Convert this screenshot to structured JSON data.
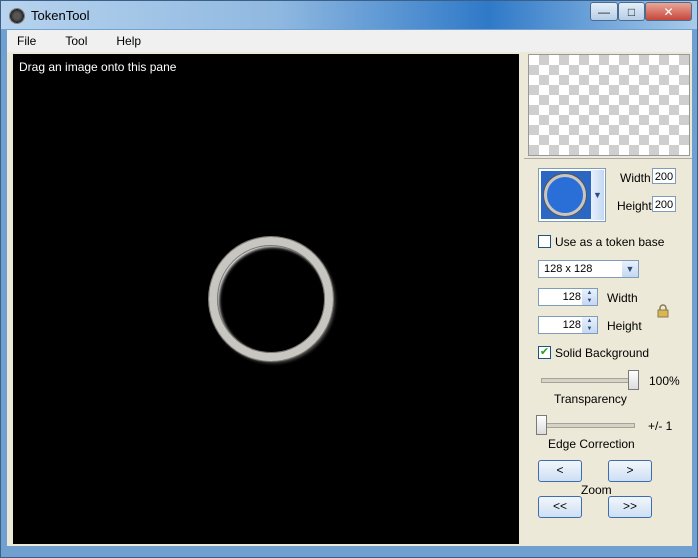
{
  "window": {
    "title": "TokenTool"
  },
  "menu": {
    "items": [
      "File",
      "Tool",
      "Help"
    ]
  },
  "canvas": {
    "hint": "Drag an image onto this pane"
  },
  "overlay": {
    "width_label": "Width",
    "width_value": "200",
    "height_label": "Height",
    "height_value": "200"
  },
  "token_base": {
    "label": "Use as a token base",
    "checked": false
  },
  "size_select": {
    "value": "128 x 128"
  },
  "dimensions": {
    "width_value": "128",
    "width_label": "Width",
    "height_value": "128",
    "height_label": "Height"
  },
  "solid_background": {
    "label": "Solid Background",
    "checked": true
  },
  "transparency": {
    "value_label": "100%",
    "label": "Transparency",
    "value": 1.0
  },
  "edge_correction": {
    "value_label": "+/- 1",
    "label": "Edge Correction",
    "value": 0.0
  },
  "zoom": {
    "label": "Zoom",
    "left": "<",
    "right": ">",
    "left_fast": "<<",
    "right_fast": ">>"
  }
}
